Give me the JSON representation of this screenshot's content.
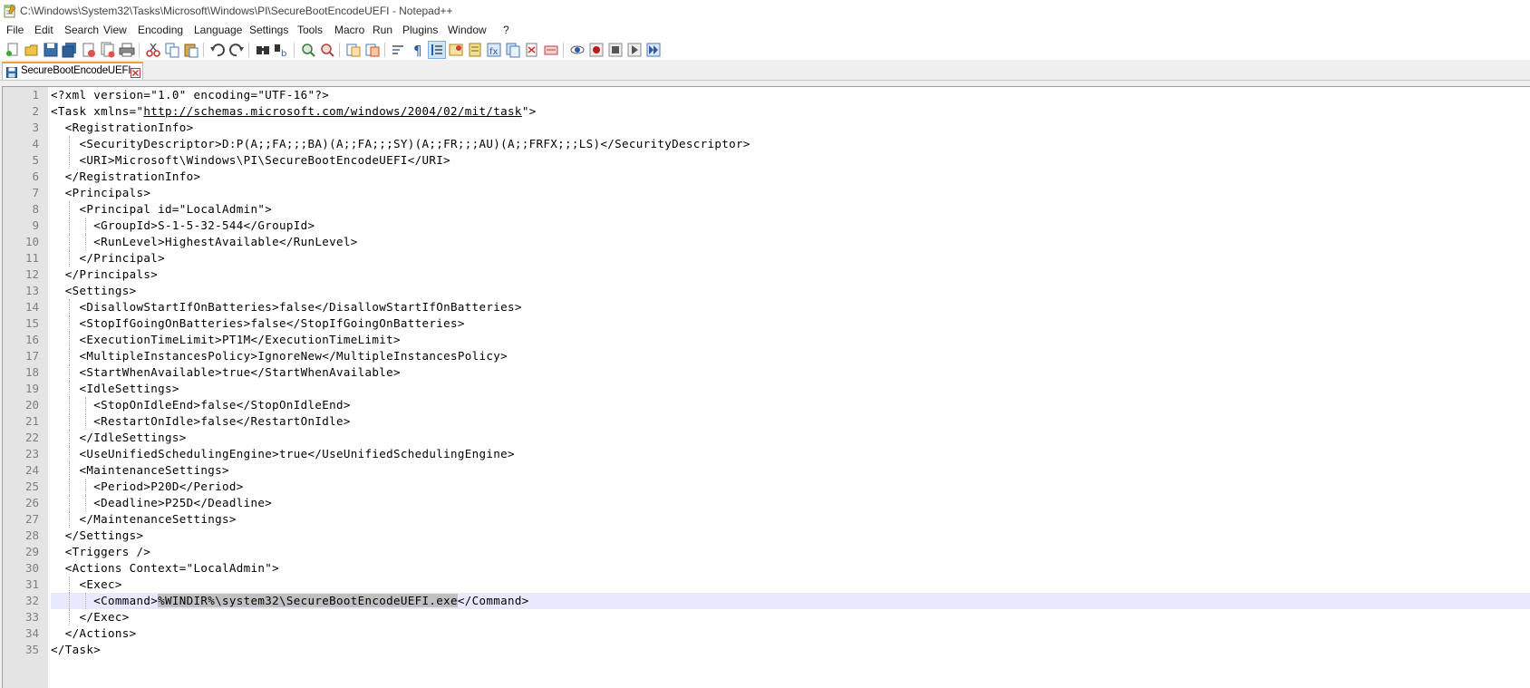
{
  "window": {
    "title": "C:\\Windows\\System32\\Tasks\\Microsoft\\Windows\\PI\\SecureBootEncodeUEFI - Notepad++"
  },
  "menu": [
    "File",
    "Edit",
    "Search",
    "View",
    "Encoding",
    "Language",
    "Settings",
    "Tools",
    "Macro",
    "Run",
    "Plugins",
    "Window",
    "?"
  ],
  "toolbar": {
    "icons": [
      "new-file-icon",
      "open-file-icon",
      "save-icon",
      "save-all-icon",
      "close-icon",
      "close-all-icon",
      "print-icon",
      "cut-icon",
      "copy-icon",
      "paste-icon",
      "undo-icon",
      "redo-icon",
      "find-icon",
      "replace-icon",
      "zoom-in-icon",
      "zoom-out-icon",
      "sync-vertical-icon",
      "sync-horizontal-icon",
      "word-wrap-icon",
      "show-all-characters-icon",
      "indent-guide-icon",
      "user-defined-language-icon",
      "document-map-icon",
      "function-list-icon",
      "folder-as-workspace-icon",
      "document-list-icon",
      "monitoring-icon",
      "record-macro-icon",
      "stop-recording-icon",
      "play-macro-icon",
      "run-macro-multiple-icon",
      "save-macro-icon"
    ],
    "active": "indent-guide-icon"
  },
  "tab": {
    "label": "SecureBootEncodeUEFI",
    "accent": "#f0a030"
  },
  "editor": {
    "current_line": 32,
    "selected_text": "%WINDIR%\\system32\\SecureBootEncodeUEFI.exe",
    "lines": [
      "<?xml version=\"1.0\" encoding=\"UTF-16\"?>",
      "<Task xmlns=\"http://schemas.microsoft.com/windows/2004/02/mit/task\">",
      "  <RegistrationInfo>",
      "    <SecurityDescriptor>D:P(A;;FA;;;BA)(A;;FA;;;SY)(A;;FR;;;AU)(A;;FRFX;;;LS)</SecurityDescriptor>",
      "    <URI>Microsoft\\Windows\\PI\\SecureBootEncodeUEFI</URI>",
      "  </RegistrationInfo>",
      "  <Principals>",
      "    <Principal id=\"LocalAdmin\">",
      "      <GroupId>S-1-5-32-544</GroupId>",
      "      <RunLevel>HighestAvailable</RunLevel>",
      "    </Principal>",
      "  </Principals>",
      "  <Settings>",
      "    <DisallowStartIfOnBatteries>false</DisallowStartIfOnBatteries>",
      "    <StopIfGoingOnBatteries>false</StopIfGoingOnBatteries>",
      "    <ExecutionTimeLimit>PT1M</ExecutionTimeLimit>",
      "    <MultipleInstancesPolicy>IgnoreNew</MultipleInstancesPolicy>",
      "    <StartWhenAvailable>true</StartWhenAvailable>",
      "    <IdleSettings>",
      "      <StopOnIdleEnd>false</StopOnIdleEnd>",
      "      <RestartOnIdle>false</RestartOnIdle>",
      "    </IdleSettings>",
      "    <UseUnifiedSchedulingEngine>true</UseUnifiedSchedulingEngine>",
      "    <MaintenanceSettings>",
      "      <Period>P20D</Period>",
      "      <Deadline>P25D</Deadline>",
      "    </MaintenanceSettings>",
      "  </Settings>",
      "  <Triggers />",
      "  <Actions Context=\"LocalAdmin\">",
      "    <Exec>",
      "      <Command>%WINDIR%\\system32\\SecureBootEncodeUEFI.exe</Command>",
      "    </Exec>",
      "  </Actions>",
      "</Task>"
    ]
  }
}
